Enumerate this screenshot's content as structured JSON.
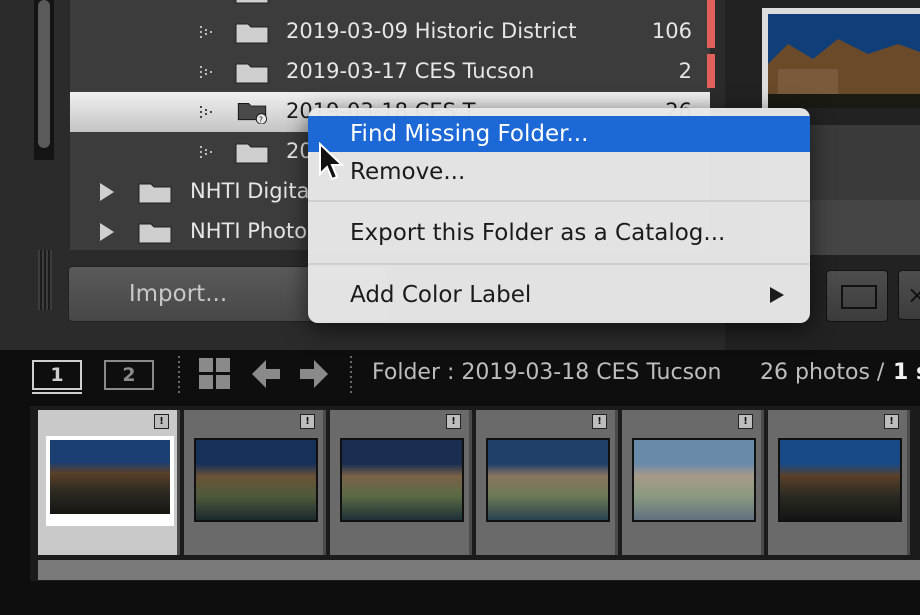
{
  "folders": [
    {
      "label": "2019-03-09 Historic District",
      "count": "106"
    },
    {
      "label": "2019-03-17 CES Tucson",
      "count": "2"
    },
    {
      "label": "2019-03-18 CES Tucson",
      "count": "26",
      "label_visible": "2019-03-18 CES T",
      "missing": true
    },
    {
      "label": "20",
      "count": ""
    }
  ],
  "parent_folders": [
    {
      "label": "NHTI Digita"
    },
    {
      "label": "NHTI Photo"
    }
  ],
  "import_button": {
    "label": "Import..."
  },
  "context_menu": {
    "items": [
      {
        "label": "Find Missing Folder...",
        "highlighted": true
      },
      {
        "label": "Remove..."
      },
      {
        "label": "Export this Folder as a Catalog..."
      },
      {
        "label": "Add Color Label",
        "has_submenu": true
      }
    ]
  },
  "toolbar": {
    "screen1": "1",
    "screen2": "2",
    "folder_status": "Folder : 2019-03-18 CES Tucson",
    "photo_count": "26 photos /",
    "selected": "1 s"
  },
  "filmstrip": {
    "badge": "!",
    "thumbnails": [
      {
        "selected": true
      },
      {
        "selected": false
      },
      {
        "selected": false
      },
      {
        "selected": false
      },
      {
        "selected": false
      },
      {
        "selected": false
      }
    ]
  },
  "colors": {
    "menu_highlight": "#1b68d6",
    "color_label_red": "#e0615b",
    "panel_bg": "#3c3c3c"
  }
}
